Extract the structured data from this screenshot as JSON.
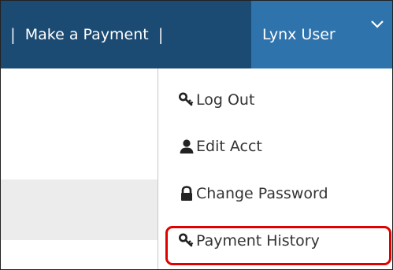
{
  "navbar": {
    "separator": "|",
    "make_payment_label": "Make a Payment",
    "user_label": "Lynx User"
  },
  "dropdown": {
    "items": [
      {
        "label": "Log Out",
        "icon": "key-icon"
      },
      {
        "label": "Edit Acct",
        "icon": "user-icon"
      },
      {
        "label": "Change Password",
        "icon": "lock-icon"
      },
      {
        "label": "Payment History",
        "icon": "key-icon"
      }
    ],
    "highlighted_item": "Payment History"
  },
  "colors": {
    "navbar_bg": "#1b4a72",
    "user_tab_bg": "#2f73ad",
    "highlight_border": "#e00000",
    "text_dark": "#333333"
  }
}
